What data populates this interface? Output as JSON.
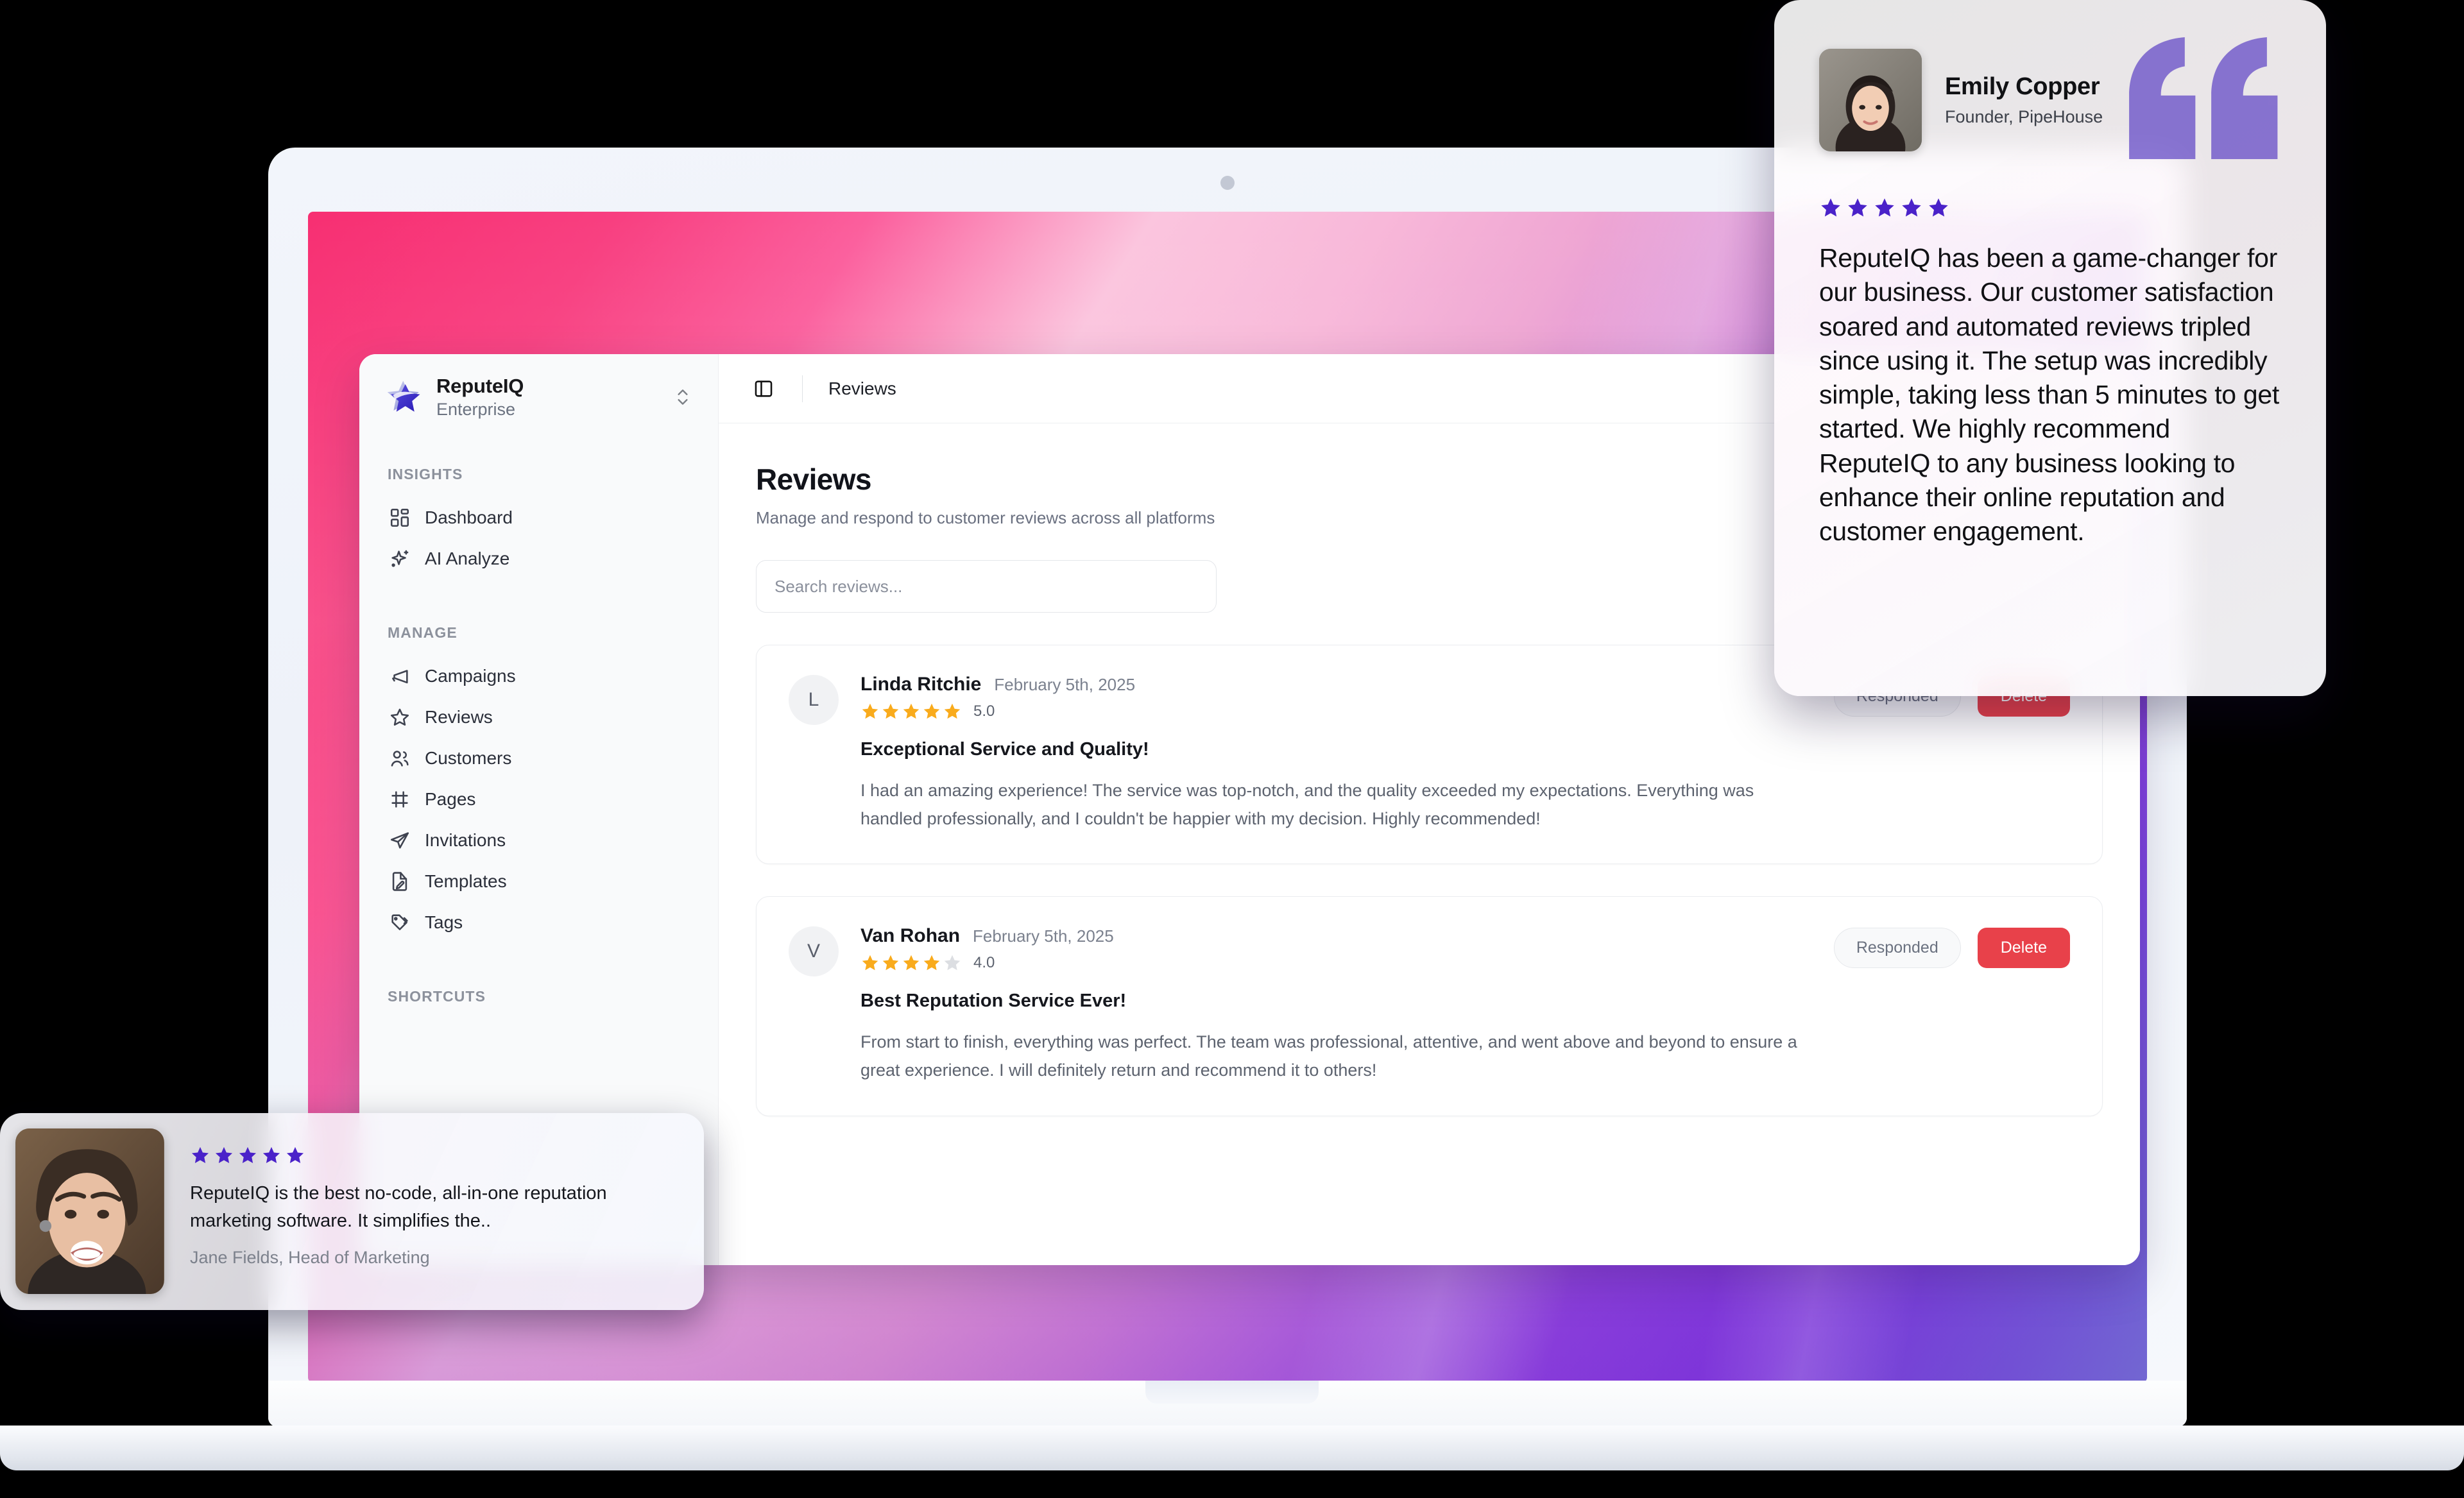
{
  "sidebar": {
    "workspace": {
      "name": "ReputeIQ",
      "plan": "Enterprise",
      "switcher_icon": "chevron-up-down-icon",
      "logo_icon": "star-logo-icon"
    },
    "sections": [
      {
        "label": "INSIGHTS",
        "items": [
          {
            "label": "Dashboard",
            "icon": "grid-dashboard-icon"
          },
          {
            "label": "AI Analyze",
            "icon": "sparkles-icon"
          }
        ]
      },
      {
        "label": "MANAGE",
        "items": [
          {
            "label": "Campaigns",
            "icon": "megaphone-icon"
          },
          {
            "label": "Reviews",
            "icon": "star-outline-icon"
          },
          {
            "label": "Customers",
            "icon": "users-icon"
          },
          {
            "label": "Pages",
            "icon": "frame-icon"
          },
          {
            "label": "Invitations",
            "icon": "paper-plane-icon"
          },
          {
            "label": "Templates",
            "icon": "file-pen-icon"
          },
          {
            "label": "Tags",
            "icon": "tags-icon"
          }
        ]
      },
      {
        "label": "SHORTCUTS",
        "items": []
      }
    ]
  },
  "topbar": {
    "toggle_icon": "panel-left-icon",
    "breadcrumb": "Reviews"
  },
  "page": {
    "title": "Reviews",
    "subtitle": "Manage and respond to customer reviews across all platforms"
  },
  "search": {
    "placeholder": "Search reviews...",
    "value": "",
    "icon": "search-icon"
  },
  "actions": {
    "responded_label": "Responded",
    "delete_label": "Delete",
    "delete_color": "#e8414a"
  },
  "reviews": [
    {
      "avatar_initial": "L",
      "name": "Linda Ritchie",
      "date": "February 5th, 2025",
      "rating": 5,
      "rating_value": "5.0",
      "title": "Exceptional Service and Quality!",
      "text": "I had an amazing experience! The service was top-notch, and the quality exceeded my expectations. Everything was handled professionally, and I couldn't be happier with my decision. Highly recommended!"
    },
    {
      "avatar_initial": "V",
      "name": "Van Rohan",
      "date": "February 5th, 2025",
      "rating": 4,
      "rating_value": "4.0",
      "title": "Best Reputation Service Ever!",
      "text": "From start to finish, everything was perfect. The team was professional, attentive, and went above and beyond to ensure a great experience. I will definitely return and recommend it to others!"
    }
  ],
  "testimonial_top": {
    "name": "Emily Copper",
    "role": "Founder, PipeHouse",
    "rating": 5,
    "quote": "ReputeIQ has been a game-changer for our business. Our customer satisfaction soared and automated reviews tripled since using it. The setup was incredibly simple, taking less than 5 minutes to get started. We highly recommend ReputeIQ to any business looking to enhance their online reputation and customer engagement.",
    "quote_icon": "quotation-mark-icon",
    "avatar_icon": "avatar-photo",
    "star_color": "#4a22c9"
  },
  "testimonial_bottom": {
    "rating": 5,
    "quote": "ReputeIQ is the best no-code, all-in-one reputation marketing software. It simplifies the..",
    "attribution": "Jane Fields, Head of Marketing",
    "avatar_icon": "avatar-photo",
    "star_color": "#4a22c9"
  },
  "colors": {
    "star_filled": "#f9ab1c",
    "star_empty": "#dcdee2",
    "accent_purple": "#4a22c9",
    "danger": "#e8414a"
  }
}
